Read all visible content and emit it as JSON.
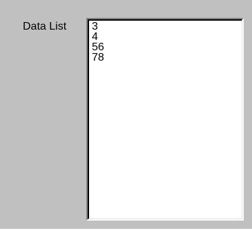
{
  "data_list": {
    "label": "Data List",
    "items": [
      "3",
      "4",
      "56",
      "78"
    ]
  },
  "colors": {
    "panel_background": "#c0c0c0",
    "list_background": "#ffffff"
  }
}
